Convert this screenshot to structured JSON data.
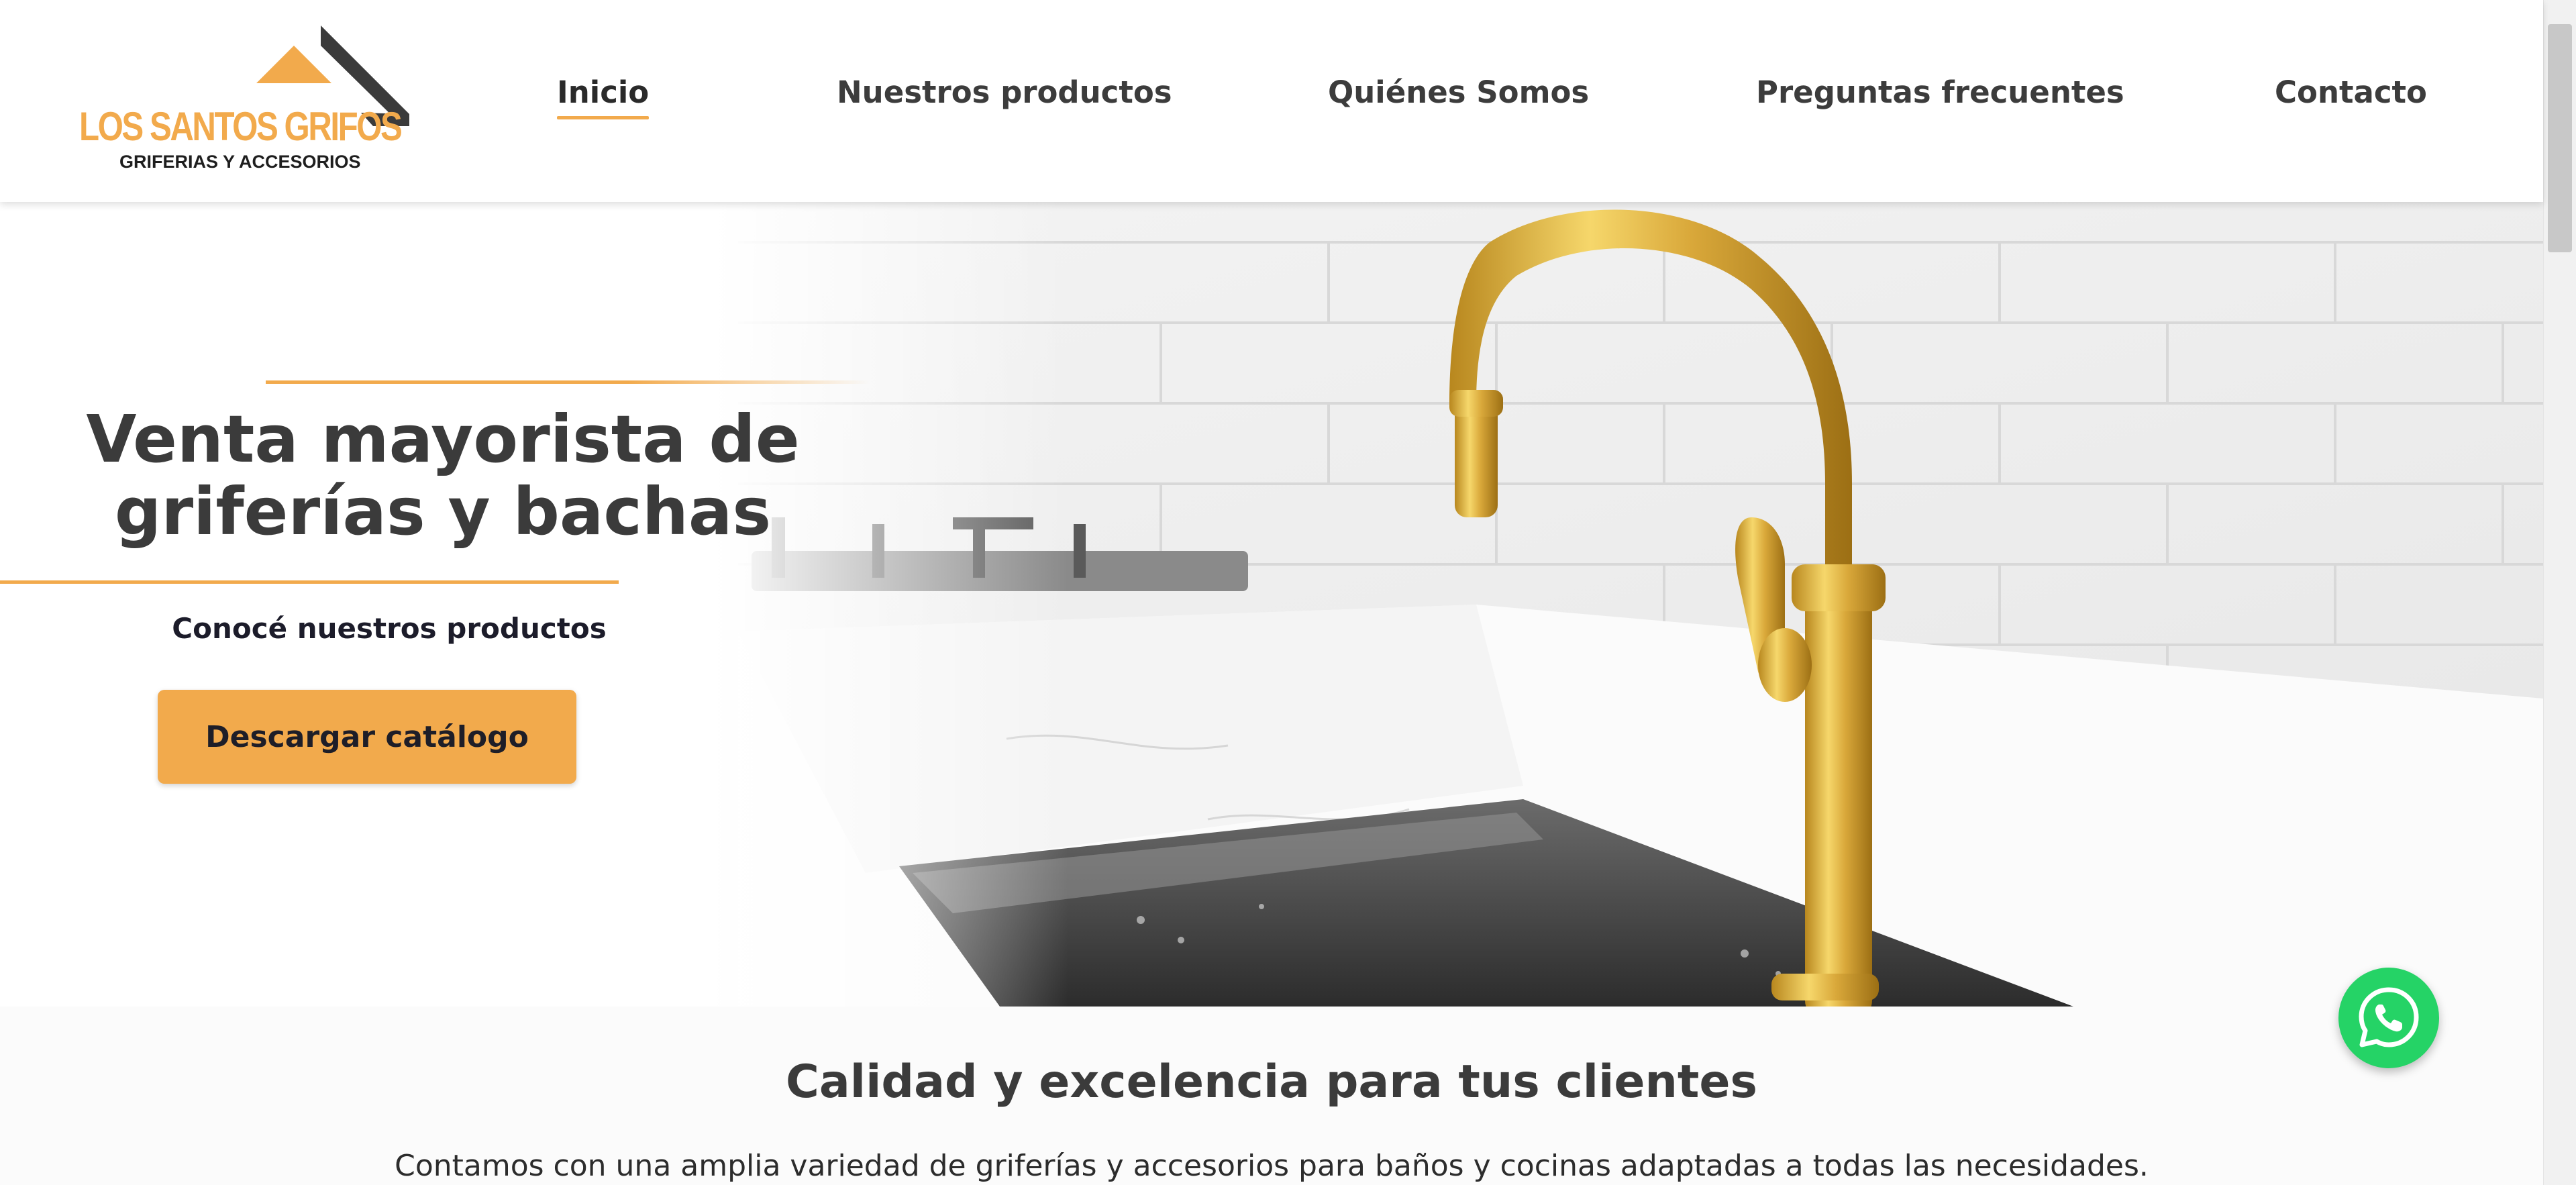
{
  "header": {
    "logo": {
      "title": "LOS SANTOS GRIFOS",
      "subtitle": "Griferias y accesorios",
      "icon": "roof-logo-icon"
    },
    "nav": [
      {
        "label": "Inicio",
        "active": true
      },
      {
        "label": "Nuestros productos",
        "active": false
      },
      {
        "label": "Quiénes Somos",
        "active": false
      },
      {
        "label": "Preguntas frecuentes",
        "active": false
      },
      {
        "label": "Contacto",
        "active": false
      }
    ]
  },
  "hero": {
    "title_line1": "Venta mayorista de",
    "title_line2": "griferías y bachas",
    "subtitle": "Conocé nuestros productos",
    "button_label": "Descargar catálogo",
    "image": "gold-faucet-kitchen-sink-photo"
  },
  "section": {
    "title": "Calidad y excelencia para tus clientes",
    "text": "Contamos con una amplia variedad de griferías y accesorios para baños y cocinas adaptadas a todas las necesidades."
  },
  "floating": {
    "icon": "whatsapp-icon"
  },
  "colors": {
    "accent": "#f2aa4c",
    "whatsapp": "#25d366",
    "text_dark": "#3b3b3b"
  }
}
